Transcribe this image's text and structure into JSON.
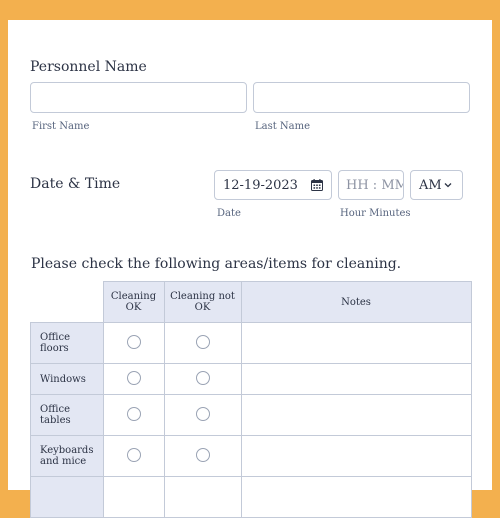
{
  "personnel": {
    "label": "Personnel Name",
    "first_value": "",
    "first_sublabel": "First Name",
    "last_value": "",
    "last_sublabel": "Last Name"
  },
  "datetime": {
    "label": "Date & Time",
    "date_value": "12-19-2023",
    "date_sublabel": "Date",
    "time_placeholder": "HH : MM",
    "time_sublabel": "Hour Minutes",
    "ampm_value": "AM"
  },
  "checklist": {
    "question": "Please check the following areas/items for cleaning.",
    "columns": [
      "Cleaning OK",
      "Cleaning not OK",
      "Notes"
    ],
    "col_lines": [
      [
        "Cleaning",
        "OK"
      ],
      [
        "Cleaning not",
        "OK"
      ],
      [
        "Notes"
      ]
    ],
    "rows": [
      [
        "Office",
        "floors"
      ],
      [
        "Windows"
      ],
      [
        "Office",
        "tables"
      ],
      [
        "Keyboards",
        "and mice"
      ]
    ]
  },
  "colors": {
    "accent": "#f3b04e",
    "header_bg": "#e3e7f3",
    "border": "#c3cad8"
  }
}
